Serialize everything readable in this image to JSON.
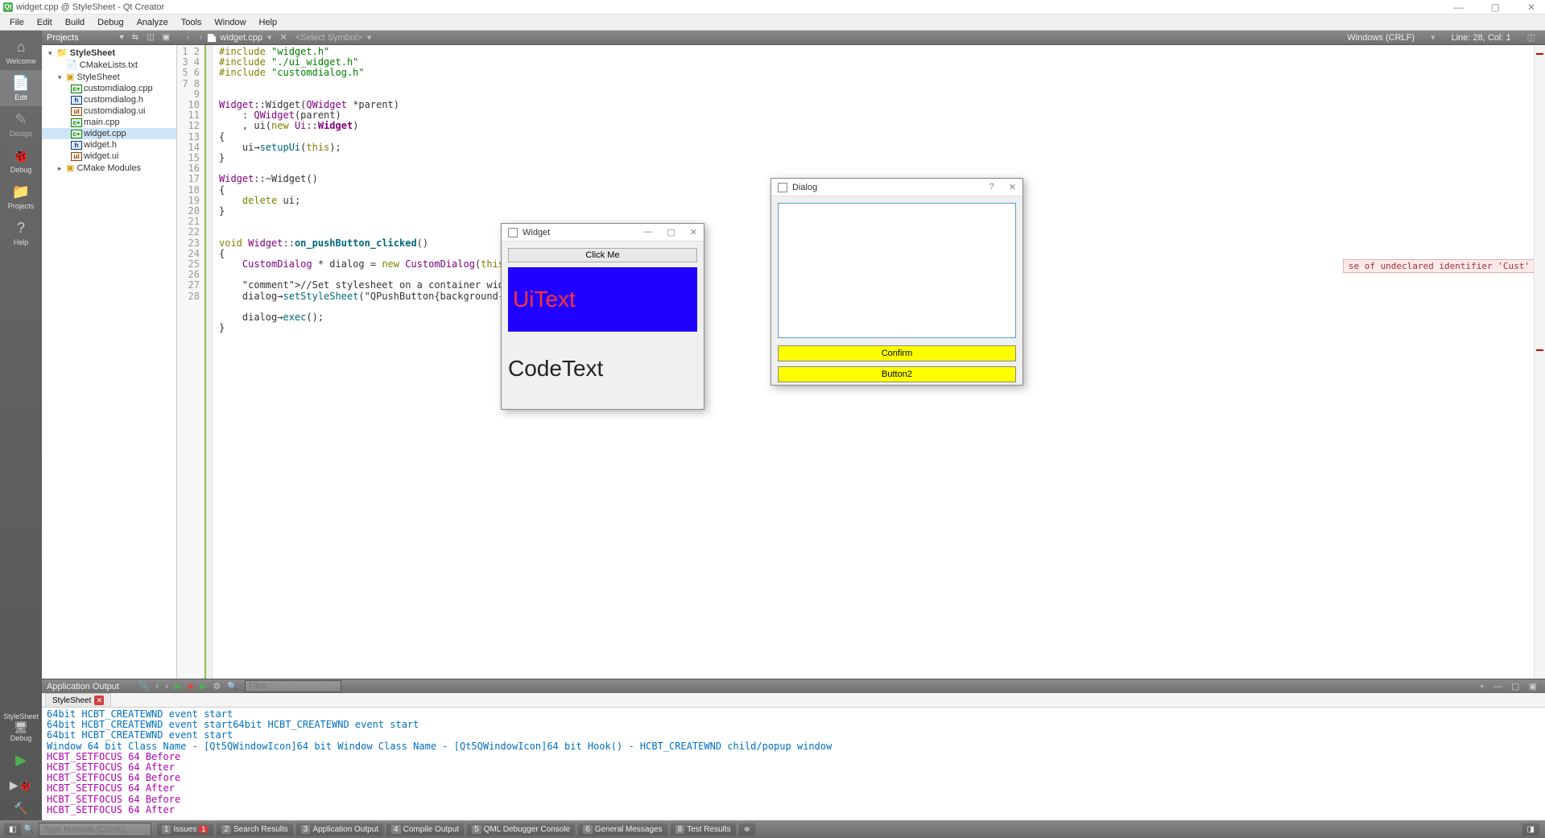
{
  "titlebar": {
    "title": "widget.cpp @ StyleSheet - Qt Creator"
  },
  "menu": [
    "File",
    "Edit",
    "Build",
    "Debug",
    "Analyze",
    "Tools",
    "Window",
    "Help"
  ],
  "rail": {
    "welcome": "Welcome",
    "edit": "Edit",
    "design": "Design",
    "debug": "Debug",
    "projects": "Projects",
    "help": "Help",
    "kit": "StyleSheet",
    "kit2": "Debug"
  },
  "proj_toolbar": {
    "label": "Projects"
  },
  "ed_toolbar": {
    "file": "widget.cpp",
    "symbol": "<Select Symbol>",
    "encoding": "Windows (CRLF)",
    "pos": "Line: 28, Col: 1"
  },
  "tree": {
    "root": "StyleSheet",
    "cmake": "CMakeLists.txt",
    "proj": "StyleSheet",
    "files": [
      "customdialog.cpp",
      "customdialog.h",
      "customdialog.ui",
      "main.cpp",
      "widget.cpp",
      "widget.h",
      "widget.ui"
    ],
    "modules": "CMake Modules"
  },
  "code": {
    "lines": [
      "#include \"widget.h\"",
      "#include \"./ui_widget.h\"",
      "#include \"customdialog.h\"",
      "",
      "",
      "Widget::Widget(QWidget *parent)",
      "    : QWidget(parent)",
      "    , ui(new Ui::Widget)",
      "{",
      "    ui->setupUi(this);",
      "}",
      "",
      "Widget::~Widget()",
      "{",
      "    delete ui;",
      "}",
      "",
      "",
      "void Widget::on_pushButton_clicked()",
      "{",
      "    CustomDialog * dialog = new CustomDialog(this);",
      "",
      "    //Set stylesheet on a container widget",
      "    dialog->setStyleSheet(\"QPushButton{background-color:",
      "",
      "    dialog->exec();",
      "}",
      ""
    ],
    "error": "se of undeclared identifier 'Cust'"
  },
  "output_panel": {
    "label": "Application Output",
    "filter_ph": "Filter",
    "tab": "StyleSheet",
    "lines": [
      {
        "c": "l1",
        "t": "64bit HCBT_CREATEWND event start"
      },
      {
        "c": "l1",
        "t": "64bit HCBT_CREATEWND event start64bit HCBT_CREATEWND event start"
      },
      {
        "c": "l1",
        "t": "64bit HCBT_CREATEWND event start"
      },
      {
        "c": "l1",
        "t": "Window 64 bit Class Name - [Qt5QWindowIcon]64 bit Window Class Name - [Qt5QWindowIcon]64 bit Hook() - HCBT_CREATEWND child/popup window"
      },
      {
        "c": "l2",
        "t": " HCBT_SETFOCUS 64 Before"
      },
      {
        "c": "l2",
        "t": " HCBT_SETFOCUS 64 After"
      },
      {
        "c": "l2",
        "t": " HCBT_SETFOCUS 64 Before"
      },
      {
        "c": "l2",
        "t": " HCBT_SETFOCUS 64 After"
      },
      {
        "c": "l2",
        "t": " HCBT_SETFOCUS 64 Before"
      },
      {
        "c": "l2",
        "t": " HCBT_SETFOCUS 64 After"
      }
    ]
  },
  "status": {
    "locator_ph": "Type to locate (Ctrl+K)",
    "tabs": [
      "Issues",
      "Search Results",
      "Application Output",
      "Compile Output",
      "QML Debugger Console",
      "General Messages",
      "Test Results"
    ],
    "issues_badge": "1"
  },
  "widget_win": {
    "title": "Widget",
    "btn": "Click Me",
    "ui_text": "UiText",
    "code_text": "CodeText"
  },
  "dialog_win": {
    "title": "Dialog",
    "confirm": "Confirm",
    "button2": "Button2"
  }
}
